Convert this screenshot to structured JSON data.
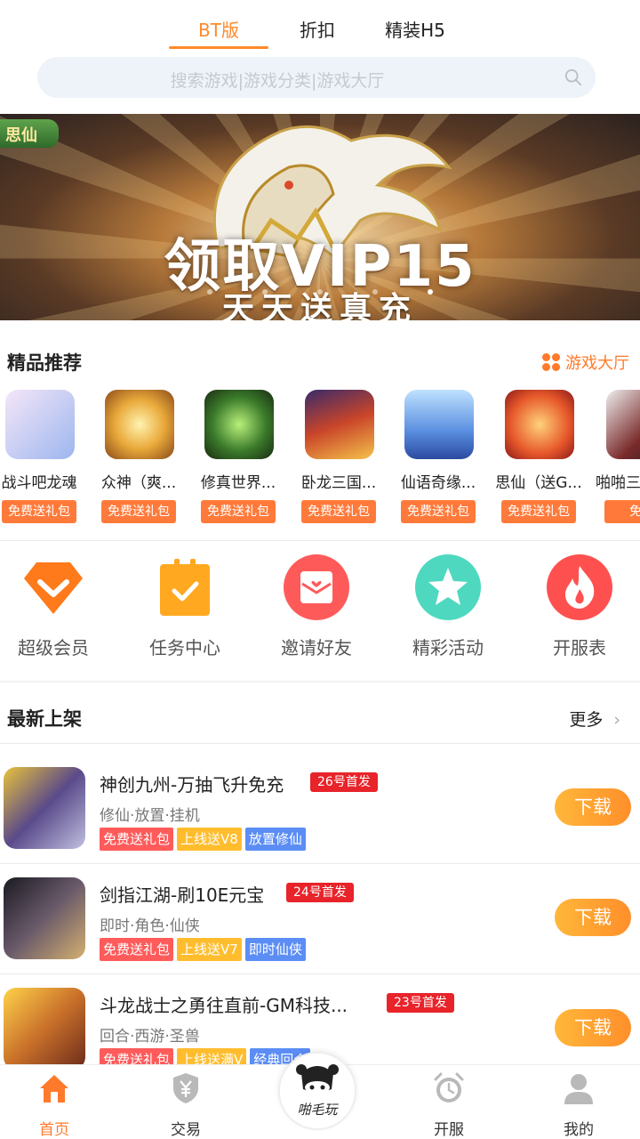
{
  "top_tabs": [
    {
      "label": "BT版",
      "active": true
    },
    {
      "label": "折扣",
      "active": false
    },
    {
      "label": "精装H5",
      "active": false
    }
  ],
  "search": {
    "placeholder": "搜索游戏|游戏分类|游戏大厅",
    "icon": "search-icon"
  },
  "banner": {
    "logo_text": "思仙",
    "title": "领取VIP15",
    "subtitle": "天天送真充"
  },
  "recommended": {
    "title": "精品推荐",
    "link_label": "游戏大厅",
    "games": [
      {
        "name": "战斗吧龙魂",
        "badge": "免费送礼包",
        "color": "#c9d6f5"
      },
      {
        "name": "众神（爽...",
        "badge": "免费送礼包",
        "color": "#e9a93a"
      },
      {
        "name": "修真世界...",
        "badge": "免费送礼包",
        "color": "#3a7a2a"
      },
      {
        "name": "卧龙三国...",
        "badge": "免费送礼包",
        "color": "#c9452a"
      },
      {
        "name": "仙语奇缘...",
        "badge": "免费送礼包",
        "color": "#5a8ee0"
      },
      {
        "name": "思仙（送G...",
        "badge": "免费送礼包",
        "color": "#e6572a"
      },
      {
        "name": "啪啪三",
        "badge": "免费",
        "color": "#7a2a2a"
      }
    ]
  },
  "features": [
    {
      "label": "超级会员",
      "icon": "diamond-icon",
      "color": "#ff7a1a"
    },
    {
      "label": "任务中心",
      "icon": "clipboard-check-icon",
      "color": "#ffa820"
    },
    {
      "label": "邀请好友",
      "icon": "envelope-heart-icon",
      "color": "#ff5a5a"
    },
    {
      "label": "精彩活动",
      "icon": "star-icon",
      "color": "#4fd8c0"
    },
    {
      "label": "开服表",
      "icon": "fire-icon",
      "color": "#ff5050"
    }
  ],
  "latest": {
    "title": "最新上架",
    "more_label": "更多",
    "games": [
      {
        "name": "神创九州-万抽飞升免充",
        "date": "26号首发",
        "tags": "修仙·放置·挂机",
        "badges": [
          "免费送礼包",
          "上线送V8",
          "放置修仙"
        ],
        "button": "下载",
        "color": "#5a4a8a"
      },
      {
        "name": "剑指江湖-刷10E元宝",
        "date": "24号首发",
        "tags": "即时·角色·仙侠",
        "badges": [
          "免费送礼包",
          "上线送V7",
          "即时仙侠"
        ],
        "button": "下载",
        "color": "#3a3a4a"
      },
      {
        "name": "斗龙战士之勇往直前-GM科技...",
        "date": "23号首发",
        "tags": "回合·西游·圣兽",
        "badges": [
          "免费送礼包",
          "上线送满V",
          "经典回合"
        ],
        "button": "下载",
        "color": "#c9702a"
      }
    ]
  },
  "bottom_nav": [
    {
      "label": "首页",
      "icon": "home-icon",
      "active": true
    },
    {
      "label": "交易",
      "icon": "shield-yen-icon",
      "active": false
    },
    {
      "label": "开服",
      "icon": "alarm-clock-icon",
      "active": false
    },
    {
      "label": "我的",
      "icon": "user-icon",
      "active": false
    }
  ],
  "center_logo": {
    "text": "啪毛玩"
  }
}
